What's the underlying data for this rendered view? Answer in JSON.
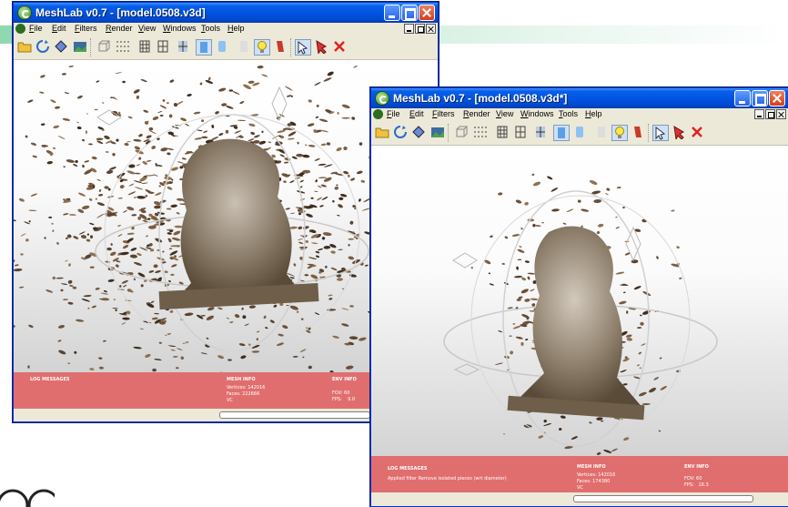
{
  "window_back": {
    "title": "MeshLab v0.7 - [model.0508.v3d]",
    "menus": [
      "File",
      "Edit",
      "Filters",
      "Render",
      "View",
      "Windows",
      "Tools",
      "Help"
    ],
    "log_header": "LOG MESSAGES",
    "log_text": "",
    "mesh_header": "MESH INFO",
    "mesh_info": "Vertices: 142016\nFaces: 222666\nVC",
    "env_header": "ENV INFO",
    "env_info": "FOV: 60\nFPS:    9.0"
  },
  "window_front": {
    "title": "MeshLab v0.7 - [model.0508.v3d*]",
    "menus": [
      "File",
      "Edit",
      "Filters",
      "Render",
      "View",
      "Windows",
      "Tools",
      "Help"
    ],
    "log_header": "LOG MESSAGES",
    "log_text": "Applied filter Remove isolated pieces (wrt diameter)",
    "mesh_header": "MESH INFO",
    "mesh_info": "Vertices: 142016\nFaces: 174380\nVC",
    "env_header": "ENV INFO",
    "env_info": "FOV: 60\nFPS:   16.3"
  },
  "toolbar_icons": [
    "open-icon",
    "reload-icon",
    "export-icon",
    "snapshot-icon",
    "bounding-box-icon",
    "points-icon",
    "wireframe-icon",
    "hidden-lines-icon",
    "flat-lines-icon",
    "flat-icon",
    "smooth-icon",
    "texture-icon",
    "lighting-icon",
    "backface-icon",
    "select-icon",
    "pick-icon",
    "delete-icon"
  ],
  "colors": {
    "titlebar": "#0054e3",
    "infobar": "#e16e6e",
    "window_chrome": "#ece9d8"
  }
}
